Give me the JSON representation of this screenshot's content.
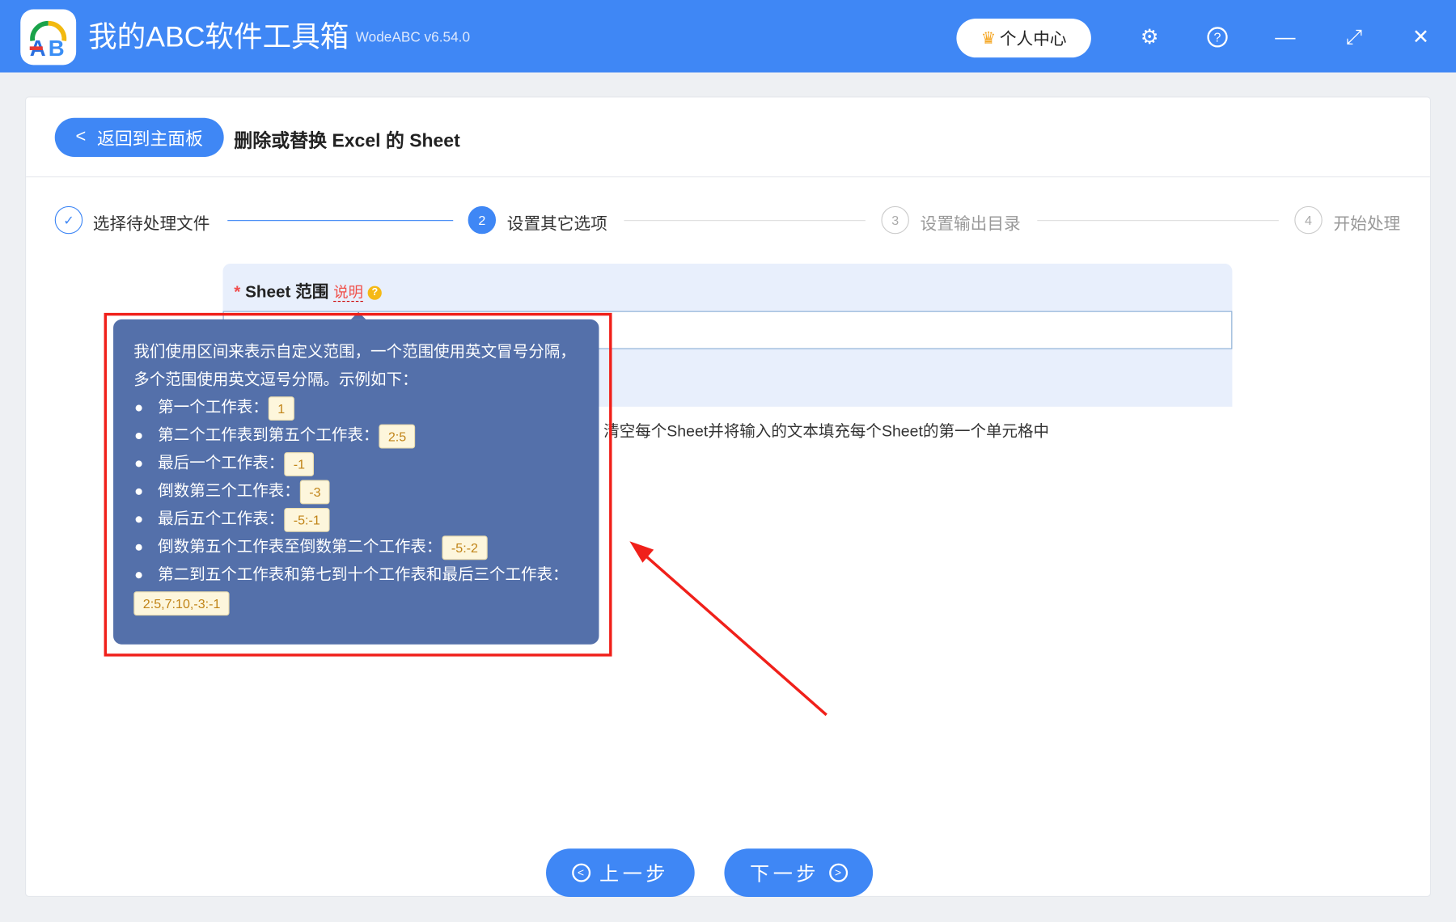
{
  "app": {
    "title": "我的ABC软件工具箱",
    "version": "WodeABC v6.54.0",
    "user_center": "个人中心"
  },
  "header": {
    "back_label": "返回到主面板",
    "page_title": "删除或替换 Excel 的 Sheet"
  },
  "steps": [
    {
      "num": "✓",
      "label": "选择待处理文件",
      "state": "done"
    },
    {
      "num": "2",
      "label": "设置其它选项",
      "state": "active"
    },
    {
      "num": "3",
      "label": "设置输出目录",
      "state": "pending"
    },
    {
      "num": "4",
      "label": "开始处理",
      "state": "pending"
    }
  ],
  "form": {
    "required_mark": "*",
    "field_label": "Sheet 范围",
    "help_link": "说明",
    "input_value": "",
    "option_text": "清空每个Sheet并将输入的文本填充每个Sheet的第一个单元格中"
  },
  "tooltip": {
    "intro": "我们使用区间来表示自定义范围，一个范围使用英文冒号分隔，多个范围使用英文逗号分隔。示例如下：",
    "examples": [
      {
        "label": "第一个工作表：",
        "code": "1"
      },
      {
        "label": "第二个工作表到第五个工作表：",
        "code": "2:5"
      },
      {
        "label": "最后一个工作表：",
        "code": "-1"
      },
      {
        "label": "倒数第三个工作表：",
        "code": "-3"
      },
      {
        "label": "最后五个工作表：",
        "code": "-5:-1"
      },
      {
        "label": "倒数第五个工作表至倒数第二个工作表：",
        "code": "-5:-2"
      },
      {
        "label": "第二到五个工作表和第七到十个工作表和最后三个工作表：",
        "code": "2:5,7:10,-3:-1"
      }
    ]
  },
  "footer": {
    "prev_label": "上一步",
    "next_label": "下一步"
  },
  "colors": {
    "brand": "#3f87f5",
    "tooltip_bg": "#5470aa",
    "annotation": "#f0201a"
  }
}
